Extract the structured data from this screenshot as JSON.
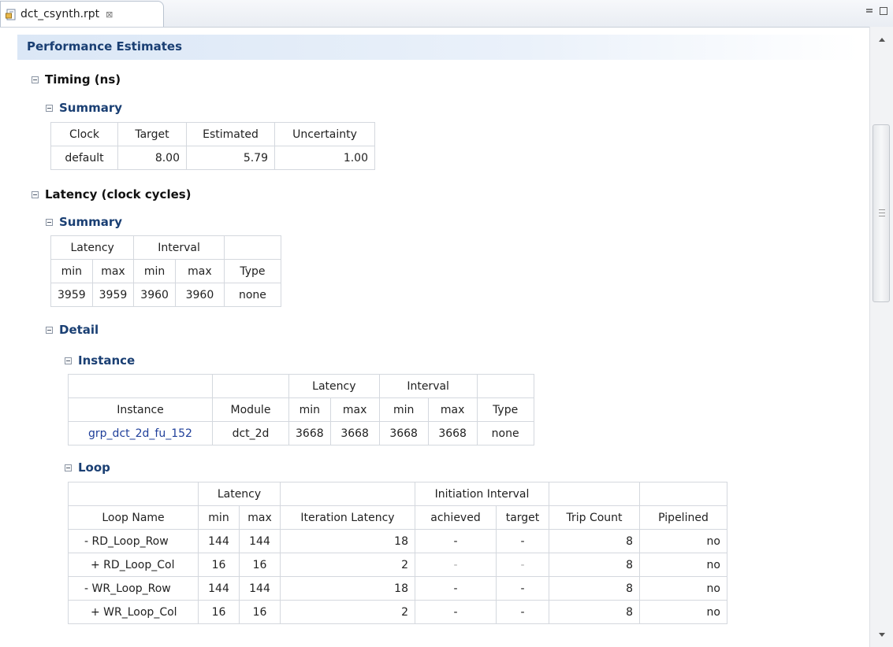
{
  "tab": {
    "title": "dct_csynth.rpt",
    "close_glyph": "⊠"
  },
  "report": {
    "section_title": "Performance Estimates",
    "timing": {
      "heading": "Timing (ns)",
      "summary_heading": "Summary",
      "headers": [
        "Clock",
        "Target",
        "Estimated",
        "Uncertainty"
      ],
      "row": [
        "default",
        "8.00",
        "5.79",
        "1.00"
      ]
    },
    "latency": {
      "heading": "Latency (clock cycles)",
      "summary_heading": "Summary",
      "summary": {
        "group_headers": [
          "Latency",
          "Interval",
          ""
        ],
        "headers": [
          "min",
          "max",
          "min",
          "max",
          "Type"
        ],
        "row": [
          "3959",
          "3959",
          "3960",
          "3960",
          "none"
        ]
      },
      "detail_heading": "Detail",
      "instance": {
        "heading": "Instance",
        "group_headers": [
          "",
          "",
          "Latency",
          "Interval",
          ""
        ],
        "headers": [
          "Instance",
          "Module",
          "min",
          "max",
          "min",
          "max",
          "Type"
        ],
        "row": [
          "grp_dct_2d_fu_152",
          "dct_2d",
          "3668",
          "3668",
          "3668",
          "3668",
          "none"
        ]
      },
      "loop": {
        "heading": "Loop",
        "group_headers": [
          "",
          "Latency",
          "",
          "Initiation Interval",
          "",
          ""
        ],
        "headers": [
          "Loop Name",
          "min",
          "max",
          "Iteration Latency",
          "achieved",
          "target",
          "Trip Count",
          "Pipelined"
        ],
        "rows": [
          [
            "- RD_Loop_Row",
            "144",
            "144",
            "18",
            "-",
            "-",
            "8",
            "no"
          ],
          [
            "+ RD_Loop_Col",
            "16",
            "16",
            "2",
            "-",
            "-",
            "8",
            "no"
          ],
          [
            "- WR_Loop_Row",
            "144",
            "144",
            "18",
            "-",
            "-",
            "8",
            "no"
          ],
          [
            "+ WR_Loop_Col",
            "16",
            "16",
            "2",
            "-",
            "-",
            "8",
            "no"
          ]
        ]
      }
    }
  },
  "colors": {
    "heading_blue": "#1a3f73",
    "link_blue": "#1f3f9a",
    "border": "#d4d8de"
  }
}
